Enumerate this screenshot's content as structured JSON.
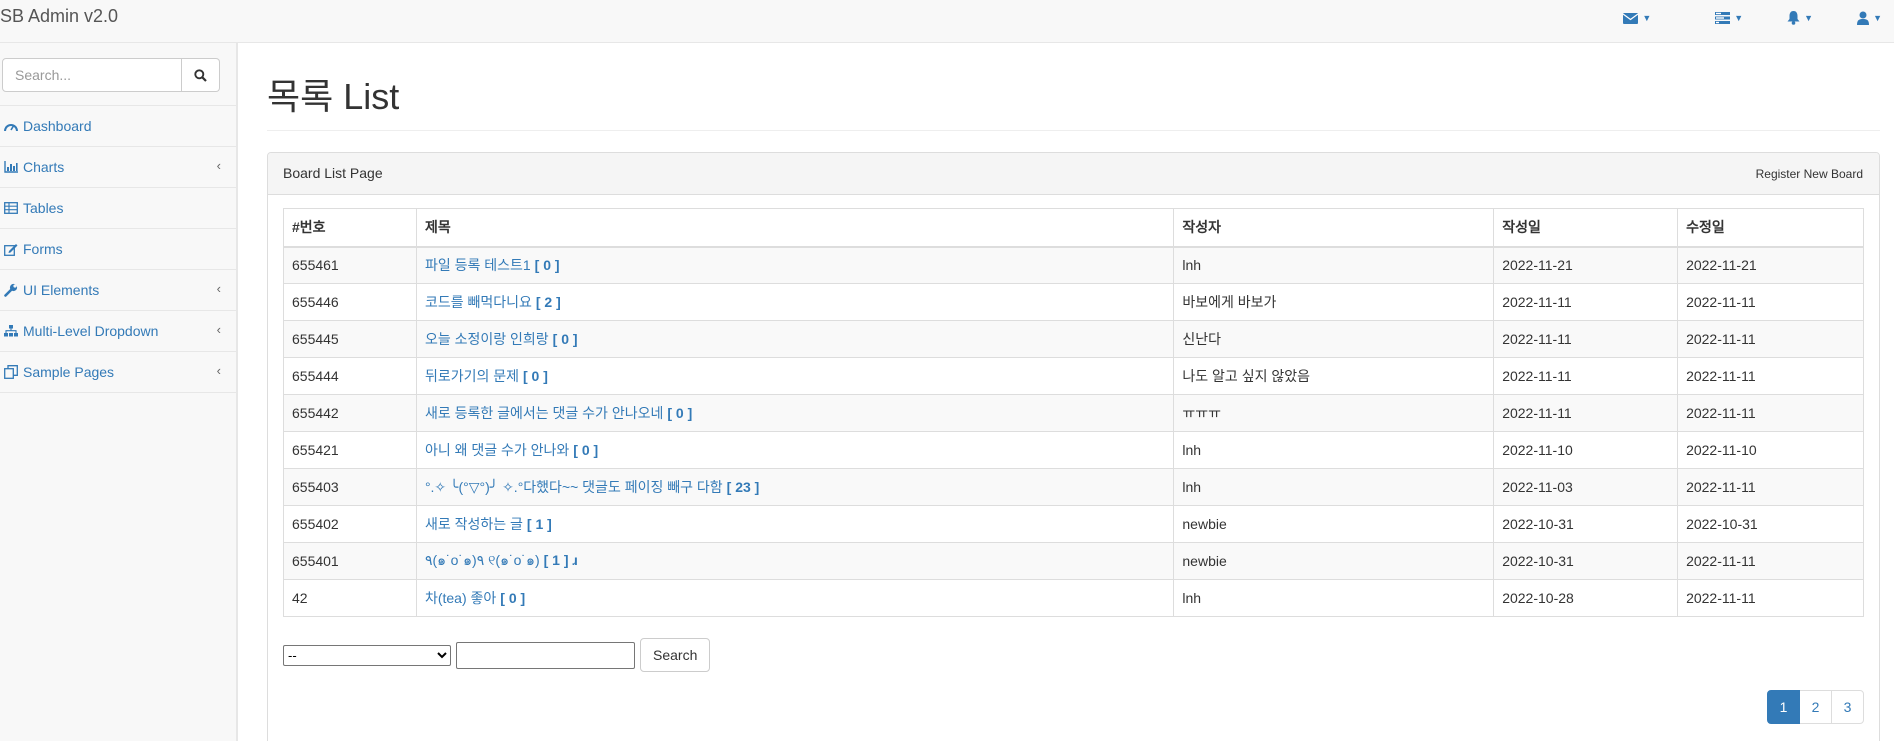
{
  "brand": "SB Admin v2.0",
  "topbar": {
    "icons": [
      "envelope-icon",
      "tasks-icon",
      "bell-icon",
      "user-icon"
    ]
  },
  "sidebar": {
    "search_placeholder": "Search...",
    "items": [
      {
        "label": "Dashboard",
        "icon": "dashboard-icon",
        "has_arrow": false
      },
      {
        "label": "Charts",
        "icon": "bar-chart-icon",
        "has_arrow": true
      },
      {
        "label": "Tables",
        "icon": "table-icon",
        "has_arrow": false
      },
      {
        "label": "Forms",
        "icon": "edit-icon",
        "has_arrow": false
      },
      {
        "label": "UI Elements",
        "icon": "wrench-icon",
        "has_arrow": true
      },
      {
        "label": "Multi-Level Dropdown",
        "icon": "sitemap-icon",
        "has_arrow": true
      },
      {
        "label": "Sample Pages",
        "icon": "files-icon",
        "has_arrow": true
      }
    ]
  },
  "page": {
    "title": "목록 List"
  },
  "panel": {
    "heading": "Board List Page",
    "register_label": "Register New Board"
  },
  "table": {
    "headers": [
      "#번호",
      "제목",
      "작성자",
      "작성일",
      "수정일"
    ],
    "rows": [
      {
        "no": "655461",
        "title": "파일 등록 테스트1",
        "replies": "[ 0 ]",
        "writer": "lnh",
        "regdate": "2022-11-21",
        "updatedate": "2022-11-21"
      },
      {
        "no": "655446",
        "title": "코드를 빼먹다니요",
        "replies": "[ 2 ]",
        "writer": "바보에게 바보가",
        "regdate": "2022-11-11",
        "updatedate": "2022-11-11"
      },
      {
        "no": "655445",
        "title": "오늘 소정이랑 인희랑",
        "replies": "[ 0 ]",
        "writer": "신난다",
        "regdate": "2022-11-11",
        "updatedate": "2022-11-11"
      },
      {
        "no": "655444",
        "title": "뒤로가기의 문제",
        "replies": "[ 0 ]",
        "writer": "나도 알고 싶지 않았음",
        "regdate": "2022-11-11",
        "updatedate": "2022-11-11"
      },
      {
        "no": "655442",
        "title": "새로 등록한 글에서는 댓글 수가 안나오네",
        "replies": "[ 0 ]",
        "writer": "ㅠㅠㅠ",
        "regdate": "2022-11-11",
        "updatedate": "2022-11-11"
      },
      {
        "no": "655421",
        "title": "아니 왜 댓글 수가 안나와",
        "replies": "[ 0 ]",
        "writer": "lnh",
        "regdate": "2022-11-10",
        "updatedate": "2022-11-10"
      },
      {
        "no": "655403",
        "title": "°.✧ ╰(°▽°)╯ ✧.°다했다~~ 댓글도 페이징 빼구 다함",
        "replies": "[ 23 ]",
        "writer": "lnh",
        "regdate": "2022-11-03",
        "updatedate": "2022-11-11"
      },
      {
        "no": "655402",
        "title": "새로 작성하는 글",
        "replies": "[ 1 ]",
        "writer": "newbie",
        "regdate": "2022-10-31",
        "updatedate": "2022-10-31"
      },
      {
        "no": "655401",
        "title": "٩(๑˙o˙๑)٩ ୧(๑˙o˙๑)",
        "replies": "[ 1 ] ɹ",
        "writer": "newbie",
        "regdate": "2022-10-31",
        "updatedate": "2022-11-11"
      },
      {
        "no": "42",
        "title": "차(tea) 좋아",
        "replies": "[ 0 ]",
        "writer": "lnh",
        "regdate": "2022-10-28",
        "updatedate": "2022-11-11"
      }
    ]
  },
  "search": {
    "type_selected": "--",
    "keyword_value": "",
    "button_label": "Search"
  },
  "pagination": {
    "pages": [
      "1",
      "2",
      "3"
    ],
    "active": "1"
  },
  "colors": {
    "link": "#337ab7",
    "active_page": "#337ab7"
  }
}
